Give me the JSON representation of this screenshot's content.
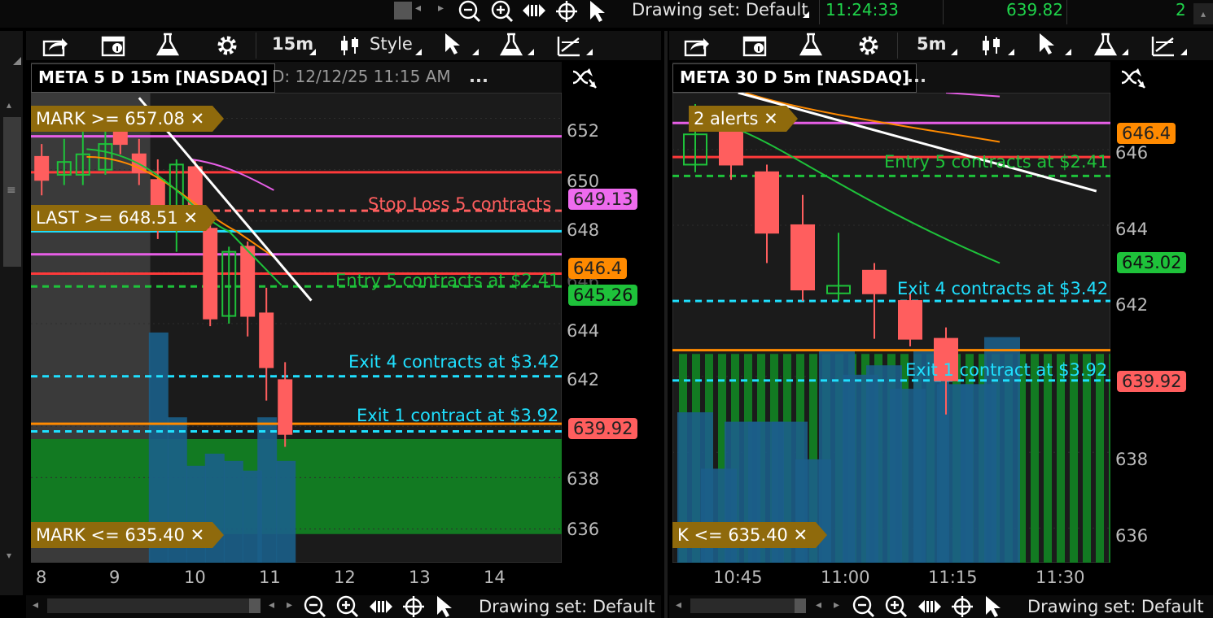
{
  "top": {
    "drawing_set": "Drawing set: Default",
    "time": "11:24:33",
    "last_price": "639.82",
    "count": "2"
  },
  "left": {
    "toolbar": {
      "timeframe": "15m",
      "style": "Style"
    },
    "title": "META 5 D 15m [NASDAQ]",
    "info": "D: 12/12/25 11:15 AM",
    "more": "...",
    "yaxis": [
      "652",
      "650",
      "648",
      "646",
      "644",
      "642",
      "638",
      "636"
    ],
    "xaxis": [
      "8",
      "9",
      "10",
      "11",
      "12",
      "13",
      "14"
    ],
    "tags": {
      "magenta": "649.13",
      "orange": "646.4",
      "green": "645.26",
      "red": "639.92"
    },
    "alerts": {
      "mark_high": "MARK >= 657.08",
      "last": "LAST >= 648.51",
      "mark_low": "MARK <= 635.40"
    },
    "orders": {
      "stop": "Stop Loss 5 contracts",
      "entry": "Entry 5 contracts at $2.41",
      "exit4": "Exit 4 contracts at $3.42",
      "exit1": "Exit 1 contract at $3.92"
    },
    "bottom": {
      "drawing_set": "Drawing set: Default"
    }
  },
  "right": {
    "toolbar": {
      "timeframe": "5m"
    },
    "title": "META 30 D 5m [NASDAQ]",
    "more": "...",
    "yaxis": [
      "646",
      "644",
      "642",
      "638",
      "636"
    ],
    "xaxis": [
      "10:45",
      "11:00",
      "11:15",
      "11:30"
    ],
    "tags": {
      "orange": "646.4",
      "green": "643.02",
      "red": "639.92"
    },
    "alerts": {
      "two": "2 alerts",
      "mark_low": "K <= 635.40"
    },
    "orders": {
      "entry": "Entry 5 contracts at $2.41",
      "exit4": "Exit 4 contracts at $3.42",
      "exit1": "Exit 1 contract at $3.92"
    },
    "bottom": {
      "drawing_set": "Drawing set: Default"
    }
  },
  "colors": {
    "up": "#1ec23a",
    "down": "#ff5e5e",
    "magenta": "#e65ee6",
    "orange": "#ff8a00",
    "red_line": "#ff3a3a",
    "cyan": "#1fe0ff",
    "green_dash": "#1ec23a",
    "volume": "#1b5f8a"
  },
  "chart_data": [
    {
      "type": "candlestick",
      "title": "META 5 D 15m [NASDAQ]",
      "x_ticks": [
        "8",
        "9",
        "10",
        "11",
        "12",
        "13",
        "14"
      ],
      "ylim": [
        635,
        653
      ],
      "levels": [
        {
          "price": 651.3,
          "name": "magenta"
        },
        {
          "price": 649.9,
          "name": "stop-loss"
        },
        {
          "price": 648.4,
          "name": "stop-dashed"
        },
        {
          "price": 647.6,
          "name": "cyan"
        },
        {
          "price": 646.7,
          "name": "magenta-2"
        },
        {
          "price": 645.95,
          "name": "red"
        },
        {
          "price": 645.45,
          "name": "entry"
        },
        {
          "price": 641.95,
          "name": "exit4"
        },
        {
          "price": 640.1,
          "name": "orange"
        },
        {
          "price": 639.8,
          "name": "exit1"
        }
      ],
      "candles": [
        {
          "x": 8.0,
          "o": 650.5,
          "c": 649.6,
          "h": 651.0,
          "l": 649.0
        },
        {
          "x": 8.3,
          "o": 649.8,
          "c": 650.3,
          "h": 651.2,
          "l": 649.4
        },
        {
          "x": 8.55,
          "o": 649.8,
          "c": 650.6,
          "h": 651.5,
          "l": 649.4
        },
        {
          "x": 8.85,
          "o": 650.0,
          "c": 651.0,
          "h": 651.6,
          "l": 649.8
        },
        {
          "x": 9.05,
          "o": 651.6,
          "c": 651.0,
          "h": 652.0,
          "l": 650.6
        },
        {
          "x": 9.3,
          "o": 650.6,
          "c": 649.9,
          "h": 651.2,
          "l": 649.4
        },
        {
          "x": 9.55,
          "o": 649.6,
          "c": 648.0,
          "h": 650.4,
          "l": 647.3
        },
        {
          "x": 9.8,
          "o": 647.9,
          "c": 650.2,
          "h": 650.4,
          "l": 646.8
        },
        {
          "x": 10.05,
          "o": 650.1,
          "c": 648.3,
          "h": 650.4,
          "l": 647.8
        },
        {
          "x": 10.25,
          "o": 647.7,
          "c": 644.2,
          "h": 647.9,
          "l": 643.9
        },
        {
          "x": 10.5,
          "o": 644.3,
          "c": 646.8,
          "h": 647.0,
          "l": 644.0
        },
        {
          "x": 10.75,
          "o": 647.0,
          "c": 644.3,
          "h": 647.2,
          "l": 643.5
        },
        {
          "x": 11.0,
          "o": 644.4,
          "c": 642.3,
          "h": 645.4,
          "l": 641.0
        },
        {
          "x": 11.25,
          "o": 641.8,
          "c": 639.7,
          "h": 642.5,
          "l": 639.2
        }
      ],
      "volume": [
        {
          "x": 9.55,
          "v": 0.95
        },
        {
          "x": 9.8,
          "v": 0.6
        },
        {
          "x": 10.05,
          "v": 0.4
        },
        {
          "x": 10.3,
          "v": 0.45
        },
        {
          "x": 10.55,
          "v": 0.42
        },
        {
          "x": 10.8,
          "v": 0.38
        },
        {
          "x": 11.0,
          "v": 0.6
        },
        {
          "x": 11.25,
          "v": 0.42
        }
      ]
    },
    {
      "type": "candlestick",
      "title": "META 30 D 5m [NASDAQ]",
      "x_ticks": [
        "10:45",
        "11:00",
        "11:15",
        "11:30"
      ],
      "ylim": [
        635.5,
        647.5
      ],
      "levels": [
        {
          "price": 646.7,
          "name": "magenta"
        },
        {
          "price": 645.8,
          "name": "red"
        },
        {
          "price": 645.3,
          "name": "entry"
        },
        {
          "price": 642.0,
          "name": "exit4"
        },
        {
          "price": 640.7,
          "name": "orange"
        },
        {
          "price": 639.9,
          "name": "exit1"
        }
      ],
      "candles": [
        {
          "x": 0.0,
          "o": 645.6,
          "c": 646.4,
          "h": 647.2,
          "l": 645.4
        },
        {
          "x": 1.0,
          "o": 646.5,
          "c": 645.6,
          "h": 647.0,
          "l": 645.2
        },
        {
          "x": 2.0,
          "o": 645.4,
          "c": 643.8,
          "h": 645.6,
          "l": 643.0
        },
        {
          "x": 3.0,
          "o": 644.0,
          "c": 642.3,
          "h": 644.8,
          "l": 642.0
        },
        {
          "x": 4.0,
          "o": 642.2,
          "c": 642.4,
          "h": 643.8,
          "l": 642.0
        },
        {
          "x": 5.0,
          "o": 642.8,
          "c": 642.2,
          "h": 643.0,
          "l": 641.0
        },
        {
          "x": 6.0,
          "o": 642.0,
          "c": 641.0,
          "h": 642.2,
          "l": 640.8
        },
        {
          "x": 7.0,
          "o": 641.0,
          "c": 639.9,
          "h": 641.3,
          "l": 639.0
        }
      ]
    }
  ]
}
